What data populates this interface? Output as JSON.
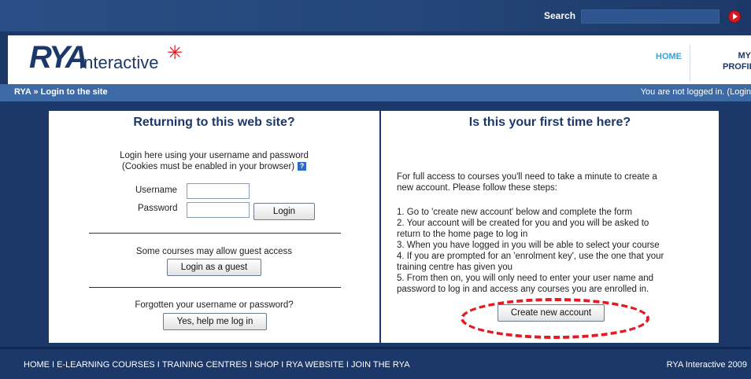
{
  "search": {
    "label": "Search",
    "value": ""
  },
  "header": {
    "logo_main": "RYA",
    "logo_sub": "Interactive",
    "nav": {
      "home": "HOME",
      "profile_line1": "MY",
      "profile_line2": "PROFILE"
    }
  },
  "breadcrumb": {
    "text": "RYA » Login to the site",
    "status": "You are not logged in. (Login"
  },
  "returning": {
    "title": "Returning to this web site?",
    "intro_line1": "Login here using your username and password",
    "intro_line2": "(Cookies must be enabled in your browser)",
    "username_label": "Username",
    "password_label": "Password",
    "login_button": "Login",
    "guest_text": "Some courses may allow guest access",
    "guest_button": "Login as a guest",
    "forgot_text": "Forgotten your username or password?",
    "help_button": "Yes, help me log in"
  },
  "first_time": {
    "title": "Is this your first time here?",
    "intro_line1": "For full access to courses you'll need to take a minute to create a",
    "intro_line2": "new account. Please follow these steps:",
    "steps": [
      "1. Go to 'create new account' below and complete the form",
      "2. Your account will be created for you and you will be asked to",
      "return to the home page to log in",
      "3. When you have logged in you will be able to select your course",
      "4. If you are prompted for an 'enrolment key', use the one that your",
      "training centre has given you",
      "5. From then on, you will only need to enter your user name and",
      "password to log in and access any courses you are enrolled in."
    ],
    "create_button": "Create new account"
  },
  "footer": {
    "links": [
      "HOME",
      "E-LEARNING COURSES",
      "TRAINING CENTRES",
      "SHOP",
      "RYA WEBSITE",
      "JOIN THE RYA"
    ],
    "separator": "I",
    "copyright": "RYA Interactive 2009"
  },
  "colors": {
    "navy": "#1b3868",
    "accent_red": "#d6181f",
    "link_blue": "#3aa0d8"
  }
}
